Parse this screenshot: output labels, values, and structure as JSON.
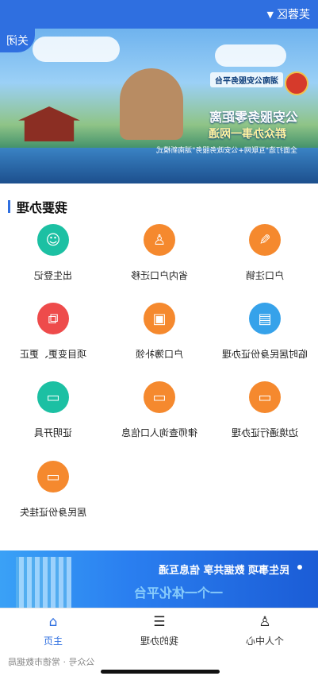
{
  "header": {
    "region": "芙蓉区",
    "region_icon": "chevron-down-icon"
  },
  "banner": {
    "close_label": "关闭",
    "platform_text": "湖南公安服务平台",
    "headline": "公安服务零距离",
    "subline": "群众办事一网通",
    "note": "全面打造\"互联网+公安政务服务\"湖南新模式"
  },
  "section": {
    "title": "我要办理"
  },
  "services": [
    {
      "label": "出生登记",
      "icon": "baby-face-icon",
      "color": "#1cc0a3"
    },
    {
      "label": "省内户口迁移",
      "icon": "person-move-icon",
      "color": "#f5892e"
    },
    {
      "label": "户口注销",
      "icon": "cancel-document-icon",
      "color": "#f5892e"
    },
    {
      "label": "项目变更、更正",
      "icon": "edit-clipboard-icon",
      "color": "#ee4b4b"
    },
    {
      "label": "户口簿补领",
      "icon": "photo-id-icon",
      "color": "#f5892e"
    },
    {
      "label": "临时居民身份证办理",
      "icon": "id-card-icon",
      "color": "#36a2ea"
    },
    {
      "label": "证明开具",
      "icon": "certificate-icon",
      "color": "#1cc0a3"
    },
    {
      "label": "律师查询人口信息",
      "icon": "id-card-icon",
      "color": "#f5892e"
    },
    {
      "label": "边境通行证办理",
      "icon": "id-card-icon",
      "color": "#f5892e"
    },
    {
      "label": "居民身份证挂失",
      "icon": "id-card-icon",
      "color": "#f5892e"
    }
  ],
  "promo": {
    "text": "民生事项 数据共享 信息互通",
    "text2": "一个一体化平台"
  },
  "tabs": [
    {
      "label": "主页",
      "icon": "home-icon",
      "active": true
    },
    {
      "label": "我的办理",
      "icon": "list-icon",
      "active": false
    },
    {
      "label": "个人中心",
      "icon": "user-icon",
      "active": false
    }
  ],
  "footer": {
    "text": "公众号 · 常德市数据局"
  }
}
